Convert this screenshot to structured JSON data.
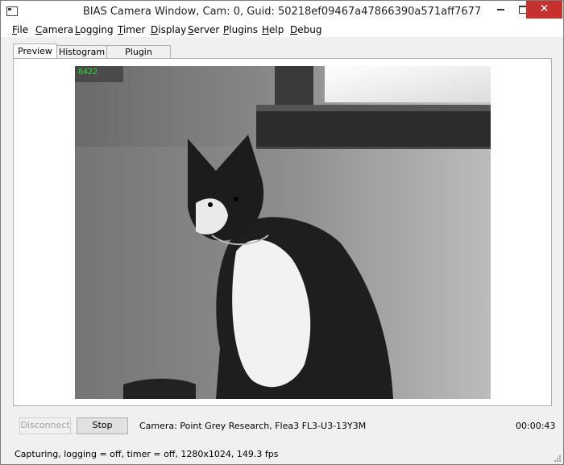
{
  "window": {
    "title": "BIAS Camera Window, Cam: 0, Guid: 50218ef09467a47866390a571aff7677",
    "minimize": "minimize",
    "maximize": "maximize",
    "close": "✕"
  },
  "menu": [
    {
      "mnemonic": "F",
      "rest": "ile"
    },
    {
      "mnemonic": "C",
      "rest": "amera"
    },
    {
      "mnemonic": "L",
      "rest": "ogging"
    },
    {
      "mnemonic": "T",
      "rest": "imer"
    },
    {
      "mnemonic": "D",
      "rest": "isplay"
    },
    {
      "mnemonic": "S",
      "rest": "erver"
    },
    {
      "mnemonic": "P",
      "rest": "lugins"
    },
    {
      "mnemonic": "H",
      "rest": "elp"
    },
    {
      "mnemonic": "D",
      "rest": "ebug"
    }
  ],
  "tabs": [
    {
      "label": "Preview",
      "active": true
    },
    {
      "label": "Histogram",
      "active": false
    },
    {
      "label": "Plugin Preview",
      "active": false
    }
  ],
  "preview": {
    "frame_counter": "6422"
  },
  "controls": {
    "disconnect_label": "Disconnect",
    "stop_label": "Stop",
    "camera_info": "Camera:  Point Grey Research,  Flea3 FL3-U3-13Y3M",
    "elapsed": "00:00:43"
  },
  "status_bar": "Capturing, logging = off, timer = off, 1280x1024,  149.3 fps"
}
